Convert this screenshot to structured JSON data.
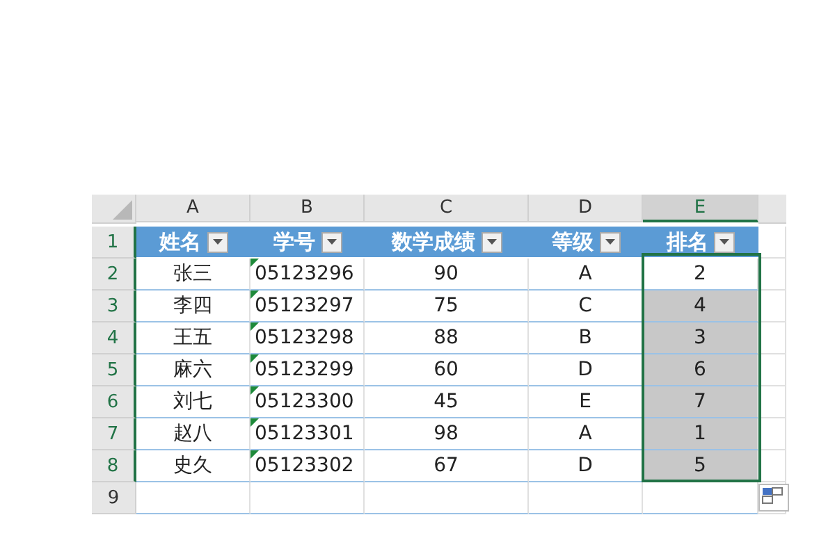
{
  "sheet": {
    "columns": [
      {
        "letter": "A",
        "selected": false
      },
      {
        "letter": "B",
        "selected": false
      },
      {
        "letter": "C",
        "selected": false
      },
      {
        "letter": "D",
        "selected": false
      },
      {
        "letter": "E",
        "selected": true
      }
    ],
    "header_row": {
      "number": "1",
      "selected": true,
      "cells": [
        {
          "label": "姓名",
          "filter": true
        },
        {
          "label": "学号",
          "filter": true
        },
        {
          "label": "数学成绩",
          "filter": true
        },
        {
          "label": "等级",
          "filter": true
        },
        {
          "label": "排名",
          "filter": true
        }
      ]
    },
    "rows": [
      {
        "number": "2",
        "selected": true,
        "active": true,
        "text_flag": true,
        "cells": [
          "张三",
          "05123296",
          "90",
          "A",
          "2"
        ]
      },
      {
        "number": "3",
        "selected": true,
        "active": false,
        "text_flag": true,
        "cells": [
          "李四",
          "05123297",
          "75",
          "C",
          "4"
        ]
      },
      {
        "number": "4",
        "selected": true,
        "active": false,
        "text_flag": true,
        "cells": [
          "王五",
          "05123298",
          "88",
          "B",
          "3"
        ]
      },
      {
        "number": "5",
        "selected": true,
        "active": false,
        "text_flag": true,
        "cells": [
          "麻六",
          "05123299",
          "60",
          "D",
          "6"
        ]
      },
      {
        "number": "6",
        "selected": true,
        "active": false,
        "text_flag": true,
        "cells": [
          "刘七",
          "05123300",
          "45",
          "E",
          "7"
        ]
      },
      {
        "number": "7",
        "selected": true,
        "active": false,
        "text_flag": true,
        "cells": [
          "赵八",
          "05123301",
          "98",
          "A",
          "1"
        ]
      },
      {
        "number": "8",
        "selected": true,
        "active": false,
        "text_flag": true,
        "cells": [
          "史久",
          "05123302",
          "67",
          "D",
          "5"
        ]
      },
      {
        "number": "9",
        "selected": false,
        "active": false,
        "text_flag": false,
        "cells": [
          "",
          "",
          "",
          "",
          ""
        ]
      }
    ]
  }
}
